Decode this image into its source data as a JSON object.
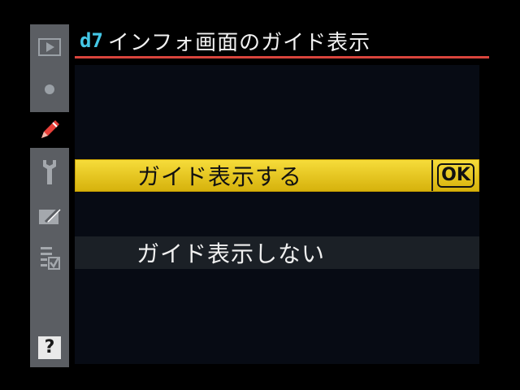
{
  "header": {
    "menu_code": "d7",
    "title": "インフォ画面のガイド表示"
  },
  "tabs": [
    {
      "icon": "playback-icon",
      "active": false
    },
    {
      "icon": "shooting-icon",
      "active": false
    },
    {
      "icon": "pencil-icon",
      "active": true
    },
    {
      "icon": "wrench-icon",
      "active": false
    },
    {
      "icon": "retouch-icon",
      "active": false
    },
    {
      "icon": "my-menu-icon",
      "active": false
    }
  ],
  "help": {
    "label": "?"
  },
  "options": [
    {
      "label": "ガイド表示する",
      "selected": true,
      "ok_label": "OK"
    },
    {
      "label": "ガイド表示しない",
      "selected": false
    }
  ],
  "colors": {
    "accent_rule": "#d9443c",
    "menu_code": "#44c7e6",
    "highlight": "#f0cf25",
    "rail": "#5b5e63",
    "pencil": "#e8403a"
  }
}
